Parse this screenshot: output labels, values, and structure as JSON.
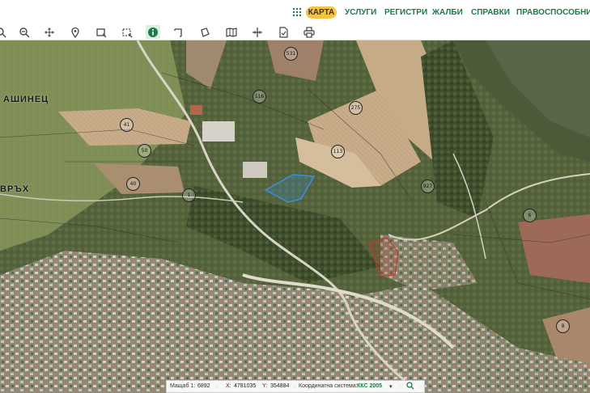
{
  "nav": {
    "active_label": "КАРТА",
    "items": [
      "УСЛУГИ",
      "РЕГИСТРИ",
      "ЖАЛБИ",
      "СПРАВКИ",
      "ПРАВОСПОСОБНИ ЛИ"
    ]
  },
  "toolbar": {
    "tools": [
      "zoom-out-icon",
      "pan-icon",
      "location-pin-icon",
      "select-rect-icon",
      "select-rect-dashed-icon",
      "info-icon",
      "measure-angle-icon",
      "measure-area-icon",
      "map-icon",
      "crosshair-icon",
      "document-icon",
      "print-icon"
    ],
    "active_tool": "info-icon",
    "accent": "#1e7a46"
  },
  "map": {
    "labels": [
      "АШИНЕЦ",
      "ВРЪХ"
    ],
    "parcels": [
      "531",
      "116",
      "275",
      "41",
      "50",
      "113",
      "40",
      "1",
      "927",
      "8",
      "6"
    ],
    "highlight_color": "#3a8fe0",
    "highlight2_color": "#c0392b"
  },
  "status": {
    "scale_label": "Мащаб 1:",
    "scale_value": "6892",
    "x_label": "X:",
    "x_value": "4781035",
    "y_label": "Y:",
    "y_value": "354884",
    "crs_label": "Координатна система:",
    "crs_value": "ККС 2005"
  }
}
